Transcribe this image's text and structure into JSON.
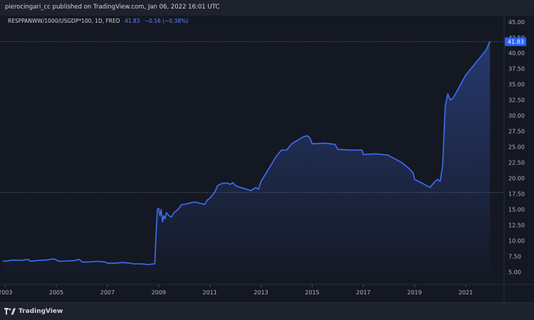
{
  "header": {
    "text": "pierocingari_cc published on TradingView.com, Jan 06, 2022 16:01 UTC"
  },
  "symbol": {
    "name": "RESPPANWW/1000/USGDP*100, 1D, FRED",
    "last": "41.83",
    "change": "−0.16 (−0.38%)"
  },
  "footer": {
    "brand": "TradingView"
  },
  "colors": {
    "line": "#3d6ef5",
    "accent": "#2962ff",
    "background": "#131722"
  },
  "chart_data": {
    "type": "area",
    "title": "RESPPANWW/1000/USGDP*100, 1D, FRED",
    "xlabel": "",
    "ylabel": "",
    "x_ticks": [
      "2003",
      "2005",
      "2007",
      "2009",
      "2011",
      "2013",
      "2015",
      "2017",
      "2019",
      "2021"
    ],
    "y_ticks": [
      "5.00",
      "7.50",
      "10.00",
      "12.50",
      "15.00",
      "17.50",
      "20.00",
      "22.50",
      "25.00",
      "27.50",
      "30.00",
      "32.50",
      "35.00",
      "37.50",
      "40.00",
      "42.50",
      "45.00"
    ],
    "ylim": [
      3.0,
      46.0
    ],
    "xlim": [
      2002.8,
      2022.5
    ],
    "last_value_label": "41.83",
    "grid": false,
    "series": [
      {
        "x": [
          2002.9,
          2003.0,
          2003.3,
          2003.6,
          2003.9,
          2004.0,
          2004.3,
          2004.6,
          2004.9,
          2005.0,
          2005.1,
          2005.4,
          2005.7,
          2005.9,
          2006.0,
          2006.3,
          2006.6,
          2006.9,
          2007.0,
          2007.3,
          2007.6,
          2007.9,
          2008.0,
          2008.3,
          2008.6,
          2008.85,
          2008.9,
          2008.95,
          2009.0,
          2009.05,
          2009.1,
          2009.15,
          2009.2,
          2009.25,
          2009.3,
          2009.4,
          2009.5,
          2009.6,
          2009.7,
          2009.8,
          2009.9,
          2010.0,
          2010.2,
          2010.4,
          2010.6,
          2010.8,
          2010.9,
          2011.0,
          2011.2,
          2011.3,
          2011.5,
          2011.7,
          2011.8,
          2011.9,
          2012.0,
          2012.2,
          2012.4,
          2012.6,
          2012.8,
          2012.9,
          2013.0,
          2013.3,
          2013.6,
          2013.8,
          2014.0,
          2014.2,
          2014.4,
          2014.6,
          2014.8,
          2014.9,
          2015.0,
          2015.5,
          2015.9,
          2016.0,
          2016.5,
          2016.95,
          2017.0,
          2017.5,
          2017.95,
          2018.0,
          2018.5,
          2018.8,
          2018.95,
          2019.0,
          2019.3,
          2019.6,
          2019.7,
          2019.8,
          2019.9,
          2020.0,
          2020.1,
          2020.2,
          2020.3,
          2020.4,
          2020.5,
          2020.6,
          2020.8,
          2021.0,
          2021.2,
          2021.4,
          2021.6,
          2021.8,
          2021.95
        ],
        "values": [
          6.8,
          6.7,
          6.9,
          6.85,
          7.0,
          6.7,
          6.85,
          6.9,
          7.1,
          6.9,
          6.7,
          6.75,
          6.8,
          7.0,
          6.6,
          6.6,
          6.7,
          6.6,
          6.4,
          6.4,
          6.5,
          6.4,
          6.3,
          6.3,
          6.2,
          6.3,
          11.0,
          15.0,
          15.2,
          14.0,
          15.0,
          13.0,
          14.0,
          13.5,
          14.5,
          14.0,
          13.8,
          14.5,
          14.8,
          15.2,
          15.8,
          15.8,
          16.0,
          16.2,
          16.0,
          15.8,
          16.5,
          16.8,
          17.8,
          18.8,
          19.2,
          19.2,
          19.0,
          19.3,
          18.8,
          18.5,
          18.3,
          18.0,
          18.5,
          18.2,
          19.5,
          21.5,
          23.5,
          24.5,
          24.5,
          25.5,
          26.0,
          26.5,
          26.8,
          26.5,
          25.5,
          25.6,
          25.4,
          24.6,
          24.5,
          24.5,
          23.8,
          23.9,
          23.7,
          23.6,
          22.5,
          21.5,
          20.8,
          19.8,
          19.2,
          18.5,
          19.0,
          19.5,
          19.8,
          19.5,
          22.0,
          31.5,
          33.5,
          32.5,
          32.8,
          33.5,
          35.0,
          36.5,
          37.5,
          38.5,
          39.5,
          40.5,
          41.9
        ],
        "line_color": "#3d6ef5"
      }
    ]
  }
}
